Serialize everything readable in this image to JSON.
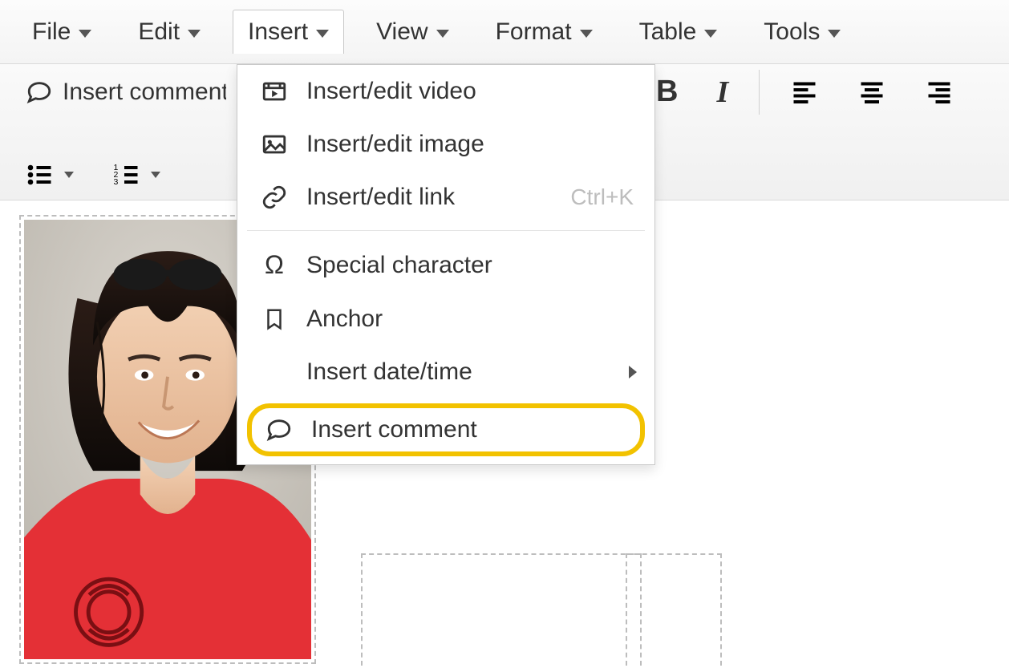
{
  "menubar": {
    "items": [
      {
        "label": "File"
      },
      {
        "label": "Edit"
      },
      {
        "label": "Insert",
        "active": true
      },
      {
        "label": "View"
      },
      {
        "label": "Format"
      },
      {
        "label": "Table"
      },
      {
        "label": "Tools"
      }
    ]
  },
  "toolbar": {
    "insert_comment_label": "Insert comment",
    "bold_glyph": "B",
    "italic_glyph": "I"
  },
  "insert_menu": {
    "video": "Insert/edit video",
    "image": "Insert/edit image",
    "link": "Insert/edit link",
    "link_shortcut": "Ctrl+K",
    "special_char": "Special character",
    "anchor": "Anchor",
    "datetime": "Insert date/time",
    "comment": "Insert comment"
  },
  "content": {
    "image_alt": "Photo of a smiling woman with sunglasses on her head wearing a red top"
  }
}
